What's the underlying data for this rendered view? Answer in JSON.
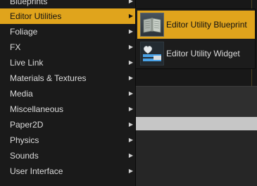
{
  "menu": {
    "items": [
      {
        "label": "Blueprints",
        "has_submenu": true
      },
      {
        "label": "Editor Utilities",
        "has_submenu": true,
        "active": true
      },
      {
        "label": "Foliage",
        "has_submenu": true
      },
      {
        "label": "FX",
        "has_submenu": true
      },
      {
        "label": "Live Link",
        "has_submenu": true
      },
      {
        "label": "Materials & Textures",
        "has_submenu": true
      },
      {
        "label": "Media",
        "has_submenu": true
      },
      {
        "label": "Miscellaneous",
        "has_submenu": true
      },
      {
        "label": "Paper2D",
        "has_submenu": true
      },
      {
        "label": "Physics",
        "has_submenu": true
      },
      {
        "label": "Sounds",
        "has_submenu": true
      },
      {
        "label": "User Interface",
        "has_submenu": true
      }
    ],
    "arrow_glyph": "▶"
  },
  "submenu": {
    "items": [
      {
        "label": "Editor Utility Blueprint",
        "icon": "blueprint-book-icon",
        "active": true
      },
      {
        "label": "Editor Utility Widget",
        "icon": "widget-heart-icon",
        "active": false
      }
    ]
  },
  "colors": {
    "highlight": "#e0a41c",
    "menu_bg": "#1a1a1a",
    "text": "#dcdcdc"
  }
}
